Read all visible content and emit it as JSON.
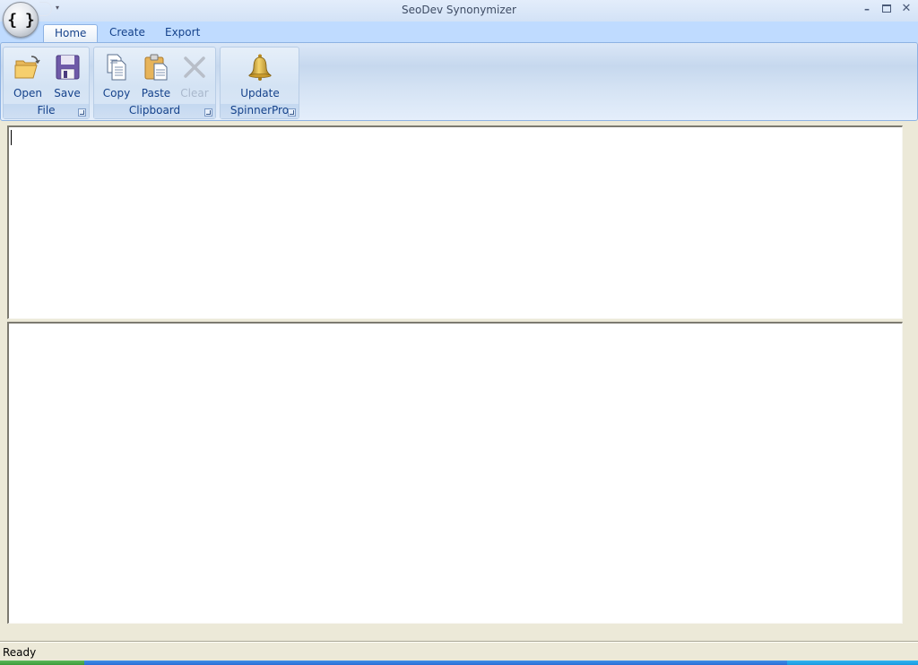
{
  "window": {
    "title": "SeoDev Synonymizer",
    "app_icon_glyph": "{ }",
    "controls": {
      "minimize": "minimize-icon",
      "maximize": "maximize-icon",
      "close": "close-icon"
    },
    "control_glyphs": {
      "minimize": "–",
      "close": "✕"
    },
    "qat_dropdown_glyph": "▾"
  },
  "ribbon": {
    "tabs": [
      {
        "label": "Home",
        "active": true
      },
      {
        "label": "Create",
        "active": false
      },
      {
        "label": "Export",
        "active": false
      }
    ],
    "groups": [
      {
        "label": "File",
        "buttons": [
          {
            "label": "Open",
            "icon": "folder-open-icon",
            "enabled": true
          },
          {
            "label": "Save",
            "icon": "floppy-disk-icon",
            "enabled": true
          }
        ]
      },
      {
        "label": "Clipboard",
        "buttons": [
          {
            "label": "Copy",
            "icon": "copy-icon",
            "enabled": true
          },
          {
            "label": "Paste",
            "icon": "paste-icon",
            "enabled": true
          },
          {
            "label": "Clear",
            "icon": "clear-x-icon",
            "enabled": false
          }
        ]
      },
      {
        "label": "SpinnerPro",
        "buttons": [
          {
            "label": "Update",
            "icon": "bell-icon",
            "enabled": true
          }
        ]
      }
    ]
  },
  "editors": {
    "input_text": "",
    "output_text": ""
  },
  "statusbar": {
    "text": "Ready"
  }
}
